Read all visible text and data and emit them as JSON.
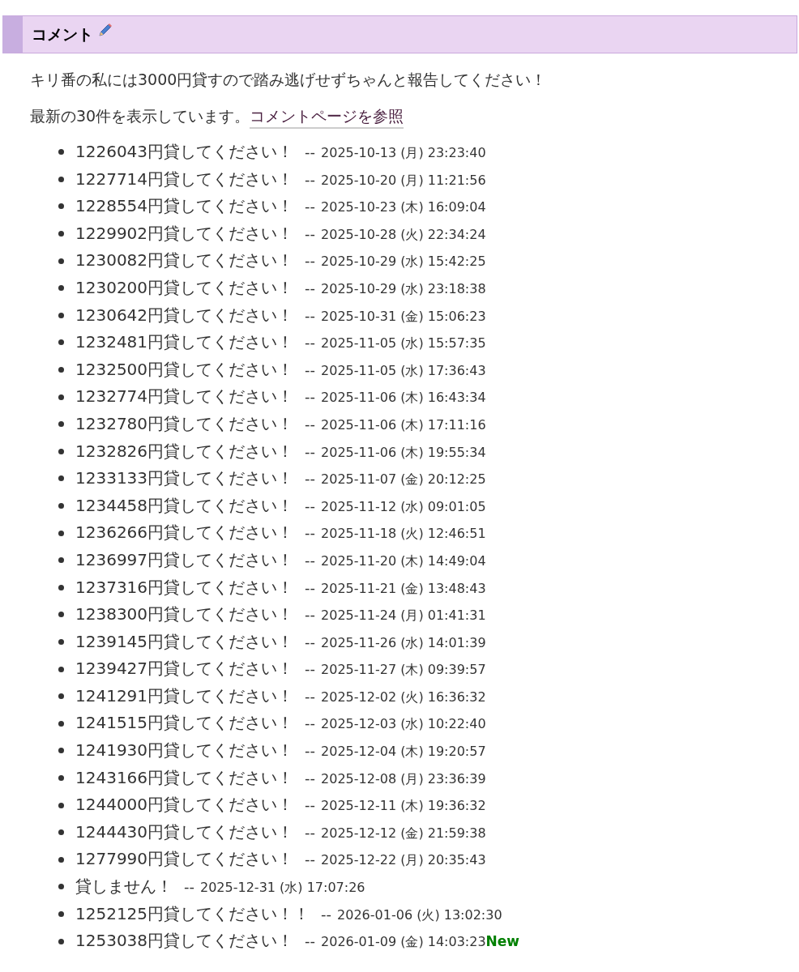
{
  "heading": {
    "title": "コメント"
  },
  "intro": "キリ番の私には3000円貸すので踏み逃げせずちゃんと報告してください！",
  "summary": {
    "text": "最新の30件を表示しています。",
    "link": "コメントページを参照"
  },
  "comments": [
    {
      "text": "1226043円貸してください！",
      "separator": "--",
      "timestamp": "2025-10-13 (月) 23:23:40"
    },
    {
      "text": "1227714円貸してください！",
      "separator": "--",
      "timestamp": "2025-10-20 (月) 11:21:56"
    },
    {
      "text": "1228554円貸してください！",
      "separator": "--",
      "timestamp": "2025-10-23 (木) 16:09:04"
    },
    {
      "text": "1229902円貸してください！",
      "separator": "--",
      "timestamp": "2025-10-28 (火) 22:34:24"
    },
    {
      "text": "1230082円貸してください！",
      "separator": "--",
      "timestamp": "2025-10-29 (水) 15:42:25"
    },
    {
      "text": "1230200円貸してください！",
      "separator": "--",
      "timestamp": "2025-10-29 (水) 23:18:38"
    },
    {
      "text": "1230642円貸してください！",
      "separator": "--",
      "timestamp": "2025-10-31 (金) 15:06:23"
    },
    {
      "text": "1232481円貸してください！",
      "separator": "--",
      "timestamp": "2025-11-05 (水) 15:57:35"
    },
    {
      "text": "1232500円貸してください！",
      "separator": "--",
      "timestamp": "2025-11-05 (水) 17:36:43"
    },
    {
      "text": "1232774円貸してください！",
      "separator": "--",
      "timestamp": "2025-11-06 (木) 16:43:34"
    },
    {
      "text": "1232780円貸してください！",
      "separator": "--",
      "timestamp": "2025-11-06 (木) 17:11:16"
    },
    {
      "text": "1232826円貸してください！",
      "separator": "--",
      "timestamp": "2025-11-06 (木) 19:55:34"
    },
    {
      "text": "1233133円貸してください！",
      "separator": "--",
      "timestamp": "2025-11-07 (金) 20:12:25"
    },
    {
      "text": "1234458円貸してください！",
      "separator": "--",
      "timestamp": "2025-11-12 (水) 09:01:05"
    },
    {
      "text": "1236266円貸してください！",
      "separator": "--",
      "timestamp": "2025-11-18 (火) 12:46:51"
    },
    {
      "text": "1236997円貸してください！",
      "separator": "--",
      "timestamp": "2025-11-20 (木) 14:49:04"
    },
    {
      "text": "1237316円貸してください！",
      "separator": "--",
      "timestamp": "2025-11-21 (金) 13:48:43"
    },
    {
      "text": "1238300円貸してください！",
      "separator": "--",
      "timestamp": "2025-11-24 (月) 01:41:31"
    },
    {
      "text": "1239145円貸してください！",
      "separator": "--",
      "timestamp": "2025-11-26 (水) 14:01:39"
    },
    {
      "text": "1239427円貸してください！",
      "separator": "--",
      "timestamp": "2025-11-27 (木) 09:39:57"
    },
    {
      "text": "1241291円貸してください！",
      "separator": "--",
      "timestamp": "2025-12-02 (火) 16:36:32"
    },
    {
      "text": "1241515円貸してください！",
      "separator": "--",
      "timestamp": "2025-12-03 (水) 10:22:40"
    },
    {
      "text": "1241930円貸してください！",
      "separator": "--",
      "timestamp": "2025-12-04 (木) 19:20:57"
    },
    {
      "text": "1243166円貸してください！",
      "separator": "--",
      "timestamp": "2025-12-08 (月) 23:36:39"
    },
    {
      "text": "1244000円貸してください！",
      "separator": "--",
      "timestamp": "2025-12-11 (木) 19:36:32"
    },
    {
      "text": "1244430円貸してください！",
      "separator": "--",
      "timestamp": "2025-12-12 (金) 21:59:38"
    },
    {
      "text": "1277990円貸してください！",
      "separator": "--",
      "timestamp": "2025-12-22 (月) 20:35:43"
    },
    {
      "text": "貸しません！",
      "separator": "--",
      "timestamp": "2025-12-31 (水) 17:07:26"
    },
    {
      "text": "1252125円貸してください！！",
      "separator": "--",
      "timestamp": "2026-01-06 (火) 13:02:30"
    },
    {
      "text": "1253038円貸してください！",
      "separator": "--",
      "timestamp": "2026-01-09 (金) 14:03:23",
      "badge": "New"
    }
  ]
}
